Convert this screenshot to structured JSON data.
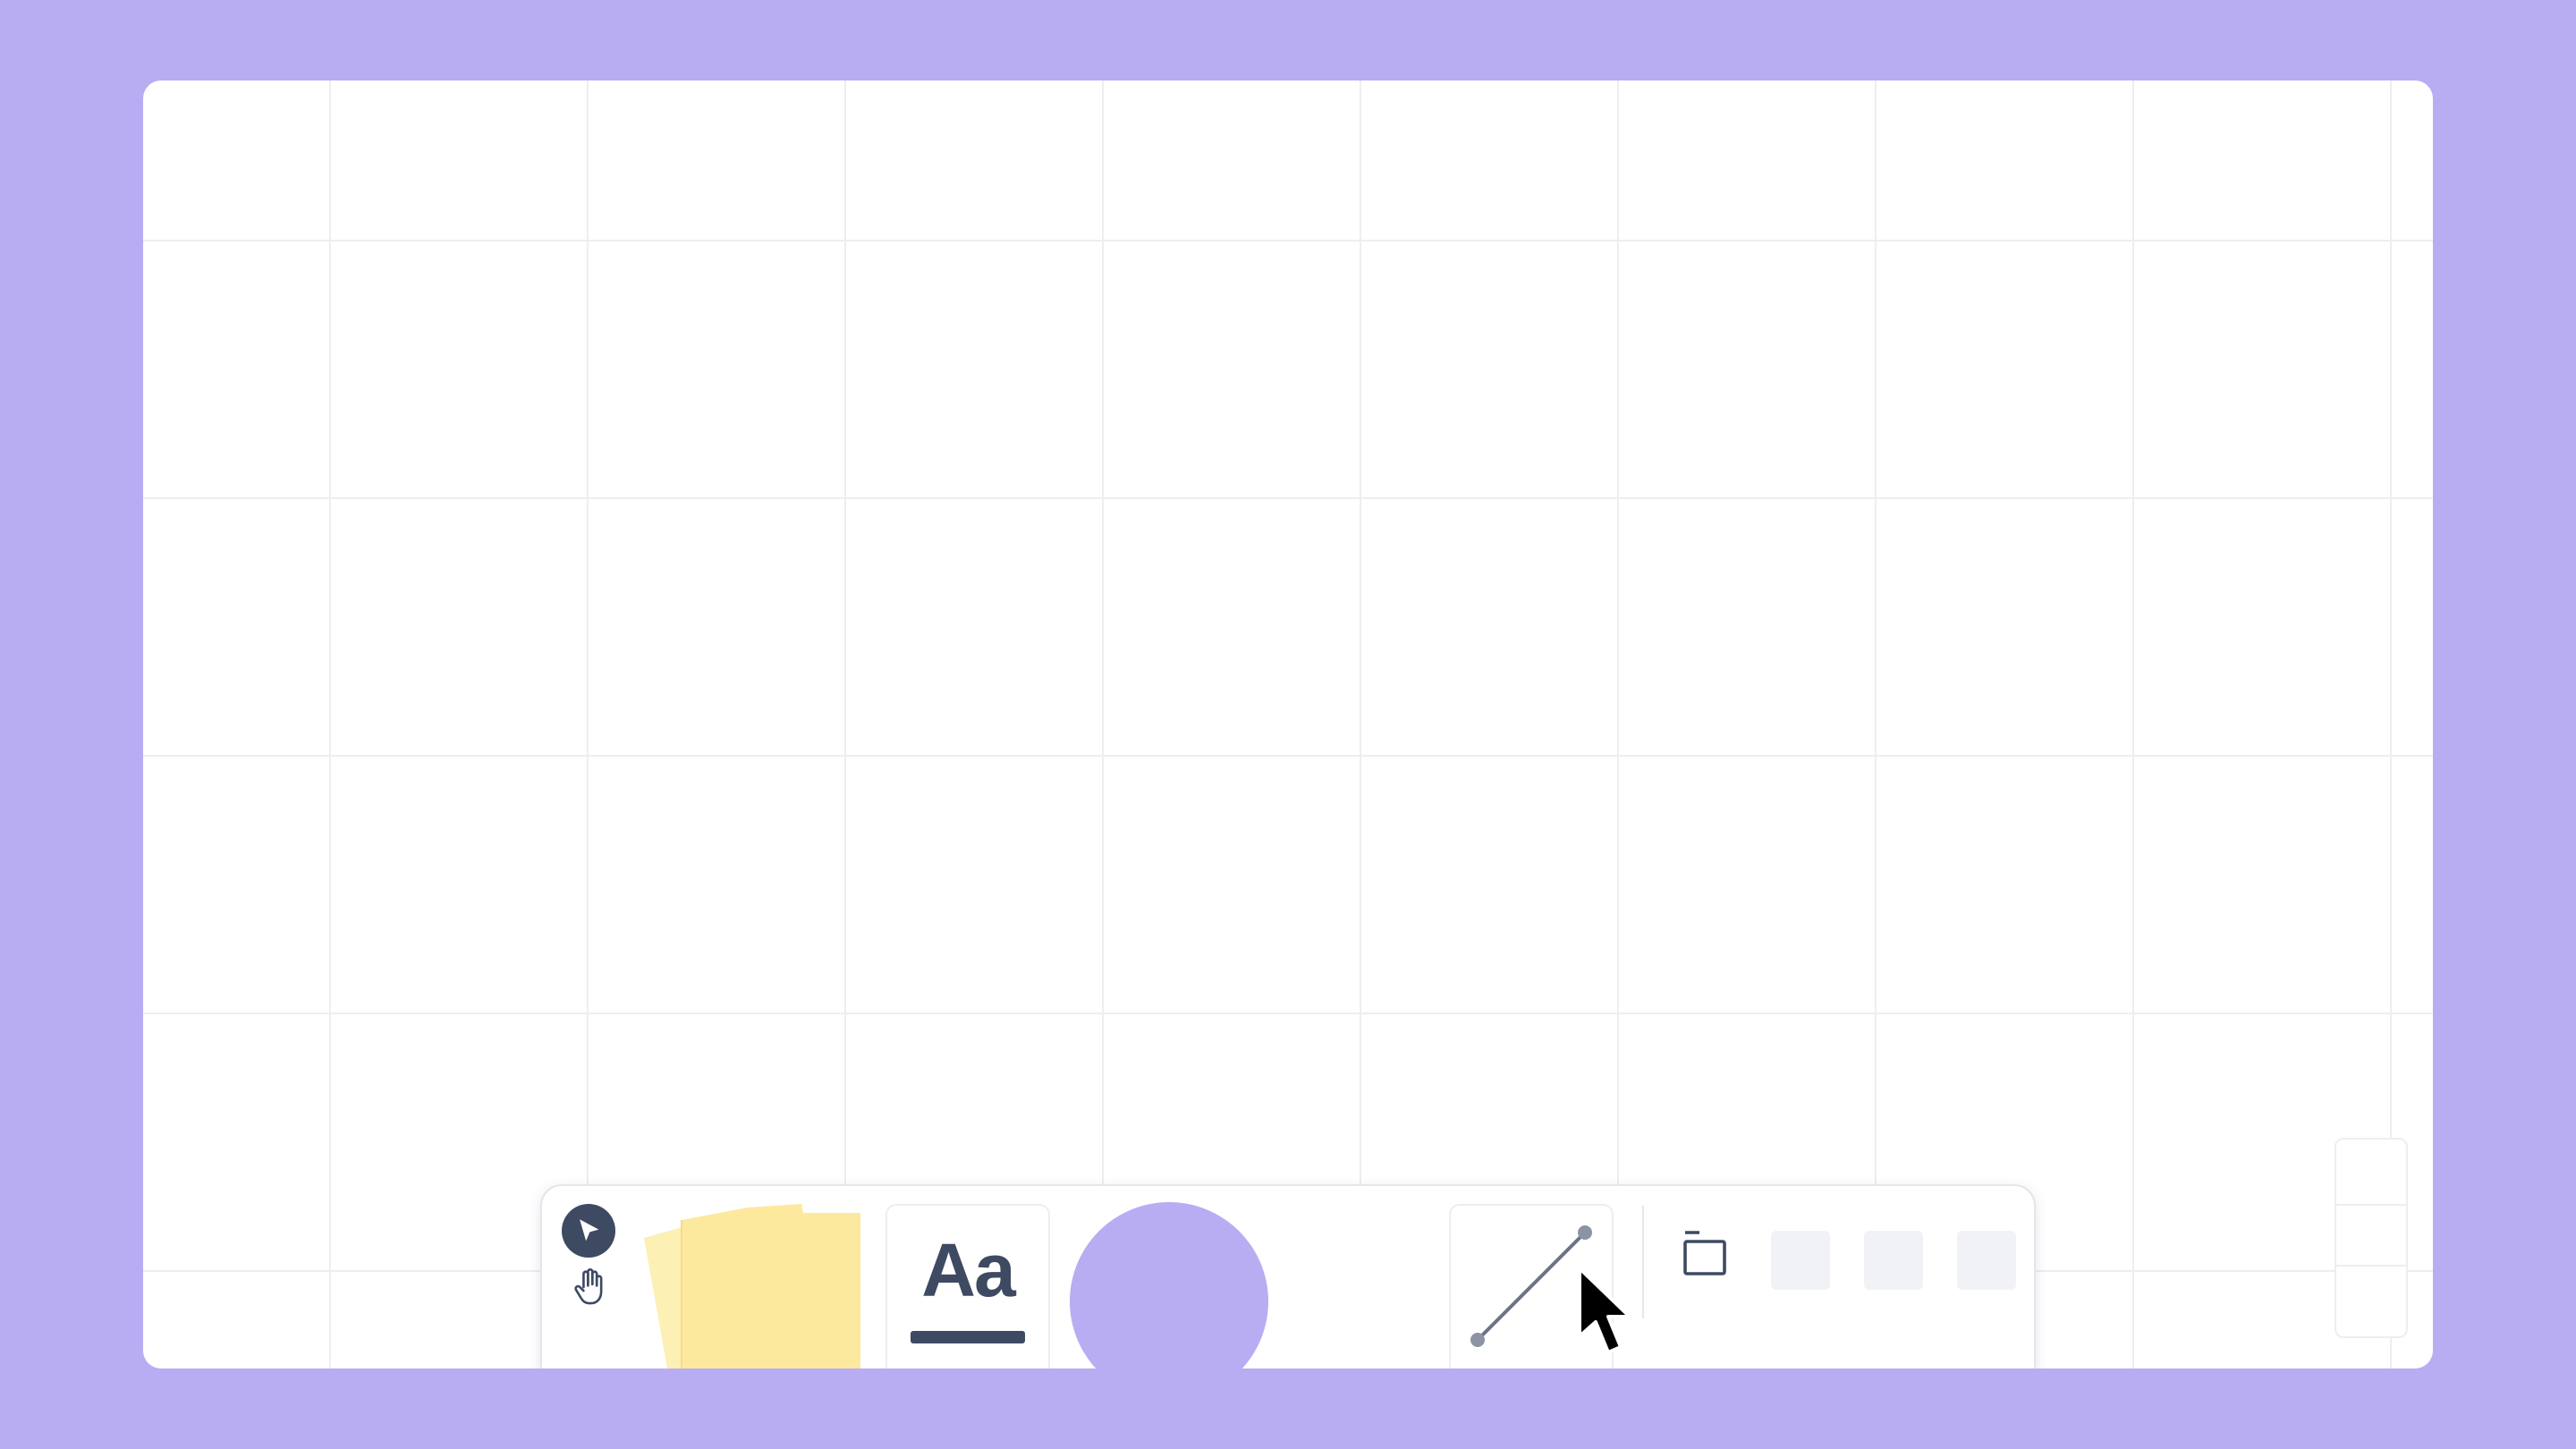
{
  "canvas": {
    "background_color": "#b8adf2",
    "board_color": "#ffffff",
    "grid_color": "#eceef2"
  },
  "toolbar": {
    "tools": [
      {
        "name": "select",
        "icon": "cursor-arrow-icon",
        "active": true
      },
      {
        "name": "hand",
        "icon": "hand-icon"
      },
      {
        "name": "sticky-note",
        "icon": "sticky-notes-icon",
        "color": "#fde99e"
      },
      {
        "name": "text",
        "label": "Aa"
      },
      {
        "name": "shape",
        "icon": "circle-shape-icon",
        "color": "#b8adf2"
      },
      {
        "name": "line",
        "icon": "line-connector-icon"
      },
      {
        "name": "frame",
        "icon": "frame-icon"
      }
    ],
    "accent_color": "#3e4a62"
  },
  "text_tool": {
    "label": "Aa"
  }
}
